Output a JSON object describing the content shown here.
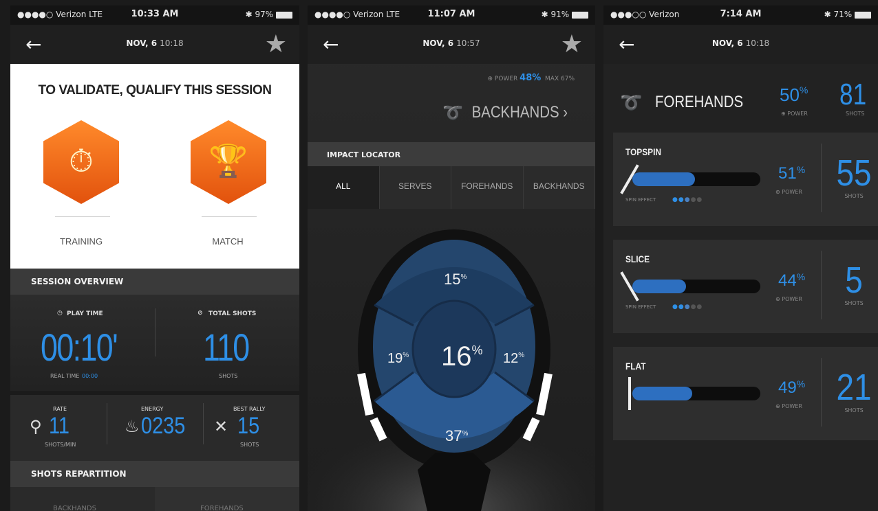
{
  "screen1": {
    "status": {
      "carrier": "●●●●○ Verizon  LTE",
      "time": "10:33 AM",
      "battery": "✱ 97%"
    },
    "nav": {
      "date": "NOV, 6",
      "time": "10:18"
    },
    "qualify": {
      "title": "TO VALIDATE, QUALIFY THIS SESSION",
      "training_label": "TRAINING",
      "match_label": "MATCH"
    },
    "overview": {
      "header": "SESSION OVERVIEW",
      "playtime_label": "PLAY TIME",
      "playtime_value": "00:10'",
      "realtime_label": "REAL TIME",
      "realtime_value": "00:00",
      "totalshots_label": "TOTAL SHOTS",
      "totalshots_value": "110",
      "shots_label": "SHOTS"
    },
    "metrics": {
      "rate_label": "RATE",
      "rate_value": "11",
      "rate_unit": "SHOTS/MIN",
      "energy_label": "ENERGY",
      "energy_value": "0235",
      "rally_label": "BEST RALLY",
      "rally_value": "15",
      "rally_unit": "SHOTS"
    },
    "repartition_header": "SHOTS REPARTITION",
    "repartition_cols": [
      "BACKHANDS",
      "FOREHANDS"
    ]
  },
  "screen2": {
    "status": {
      "carrier": "●●●●○ Verizon  LTE",
      "time": "11:07 AM",
      "battery": "✱ 91%"
    },
    "nav": {
      "date": "NOV, 6",
      "time": "10:57"
    },
    "power_label": "POWER",
    "power_value": "48",
    "max_label": "MAX",
    "max_value": "67",
    "stroke_title": "BACKHANDS",
    "impact_header": "IMPACT LOCATOR",
    "tabs": [
      "ALL",
      "SERVES",
      "FOREHANDS",
      "BACKHANDS"
    ],
    "zones": {
      "top": "15",
      "left": "19",
      "center": "16",
      "right": "12",
      "bottom": "37"
    }
  },
  "screen3": {
    "status": {
      "carrier": "●●●○○ Verizon",
      "time": "7:14 AM",
      "battery": "✱ 71%"
    },
    "nav": {
      "date": "NOV, 6",
      "time": "10:18"
    },
    "title": "FOREHANDS",
    "power_value": "50",
    "power_label": "POWER",
    "shots_value": "81",
    "shots_label": "SHOTS",
    "cards": [
      {
        "name": "TOPSPIN",
        "spin_label": "SPIN EFFECT",
        "power": "51",
        "power_label": "POWER",
        "shots": "55",
        "shots_label": "SHOTS",
        "fill": 0.49
      },
      {
        "name": "SLICE",
        "spin_label": "SPIN EFFECT",
        "power": "44",
        "power_label": "POWER",
        "shots": "5",
        "shots_label": "SHOTS",
        "fill": 0.42
      },
      {
        "name": "FLAT",
        "spin_label": "",
        "power": "49",
        "power_label": "POWER",
        "shots": "21",
        "shots_label": "SHOTS",
        "fill": 0.47
      }
    ],
    "colors": {
      "accent": "#2e8fe6",
      "bar": "#2d6fc0"
    }
  }
}
